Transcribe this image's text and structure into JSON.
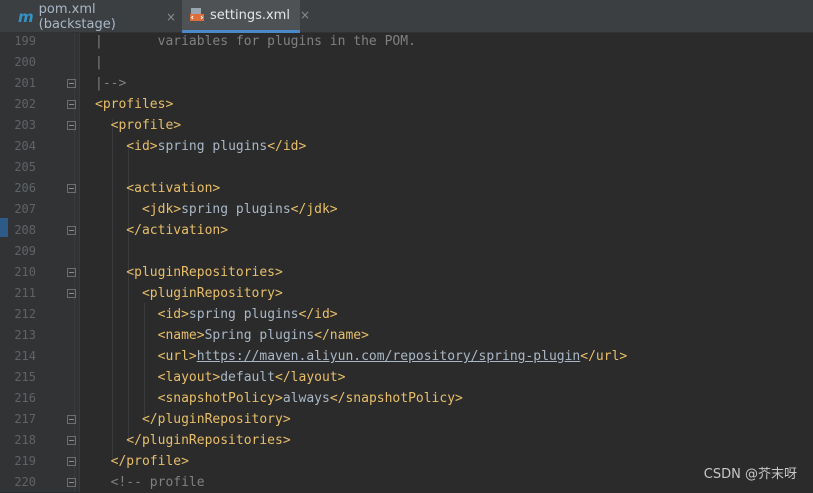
{
  "tabs": [
    {
      "label": "pom.xml (backstage)",
      "icon": "maven-m-icon",
      "active": false
    },
    {
      "label": "settings.xml",
      "icon": "xml-file-icon",
      "active": true
    }
  ],
  "tab_close_glyph": "×",
  "lines": [
    {
      "num": "199",
      "segs": [
        [
          "cmt",
          "|       variables for plugins in the POM."
        ]
      ]
    },
    {
      "num": "200",
      "segs": [
        [
          "cmt",
          "|"
        ]
      ]
    },
    {
      "num": "201",
      "segs": [
        [
          "cmt",
          "|-->"
        ]
      ]
    },
    {
      "num": "202",
      "segs": [
        [
          "tag",
          "<profiles>"
        ]
      ]
    },
    {
      "num": "203",
      "segs": [
        [
          "tag",
          "  <profile>"
        ]
      ]
    },
    {
      "num": "204",
      "segs": [
        [
          "tag",
          "    <id>"
        ],
        [
          "txt",
          "spring plugins"
        ],
        [
          "tag",
          "</id>"
        ]
      ]
    },
    {
      "num": "205",
      "segs": []
    },
    {
      "num": "206",
      "segs": [
        [
          "tag",
          "    <activation>"
        ]
      ]
    },
    {
      "num": "207",
      "segs": [
        [
          "tag",
          "      <jdk>"
        ],
        [
          "txt",
          "spring plugins"
        ],
        [
          "tag",
          "</jdk>"
        ]
      ]
    },
    {
      "num": "208",
      "segs": [
        [
          "tag",
          "    </activation>"
        ]
      ]
    },
    {
      "num": "209",
      "segs": []
    },
    {
      "num": "210",
      "segs": [
        [
          "tag",
          "    <pluginRepositories>"
        ]
      ]
    },
    {
      "num": "211",
      "segs": [
        [
          "tag",
          "      <pluginRepository>"
        ]
      ]
    },
    {
      "num": "212",
      "segs": [
        [
          "tag",
          "        <id>"
        ],
        [
          "txt",
          "spring plugins"
        ],
        [
          "tag",
          "</id>"
        ]
      ]
    },
    {
      "num": "213",
      "segs": [
        [
          "tag",
          "        <name>"
        ],
        [
          "txt",
          "Spring plugins"
        ],
        [
          "tag",
          "</name>"
        ]
      ]
    },
    {
      "num": "214",
      "segs": [
        [
          "tag",
          "        <url>"
        ],
        [
          "url",
          "https://maven.aliyun.com/repository/spring-plugin"
        ],
        [
          "tag",
          "</url>"
        ]
      ]
    },
    {
      "num": "215",
      "segs": [
        [
          "tag",
          "        <layout>"
        ],
        [
          "txt",
          "default"
        ],
        [
          "tag",
          "</layout>"
        ]
      ]
    },
    {
      "num": "216",
      "segs": [
        [
          "tag",
          "        <snapshotPolicy>"
        ],
        [
          "txt",
          "always"
        ],
        [
          "tag",
          "</snapshotPolicy>"
        ]
      ]
    },
    {
      "num": "217",
      "segs": [
        [
          "tag",
          "      </pluginRepository>"
        ]
      ]
    },
    {
      "num": "218",
      "segs": [
        [
          "tag",
          "    </pluginRepositories>"
        ]
      ]
    },
    {
      "num": "219",
      "segs": [
        [
          "tag",
          "  </profile>"
        ]
      ]
    },
    {
      "num": "220",
      "segs": [
        [
          "cmt",
          "  <!-- profile"
        ]
      ]
    }
  ],
  "fold_lines": [
    "201",
    "202",
    "203",
    "206",
    "208",
    "210",
    "211",
    "217",
    "218",
    "219",
    "220"
  ],
  "watermark": "CSDN @芥末呀",
  "colors": {
    "tag": "#e8bf6a",
    "text": "#a9b7c6",
    "comment": "#808080",
    "background": "#2b2b2b"
  }
}
